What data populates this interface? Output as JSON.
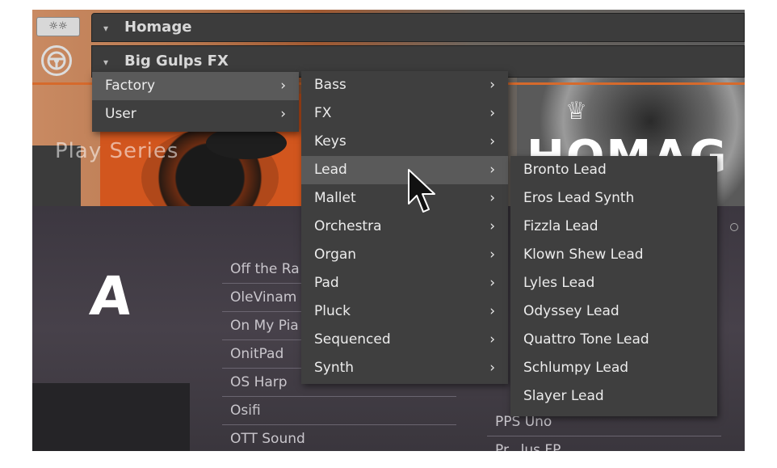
{
  "header": {
    "settings_label": "☼☼",
    "instrument_title": "Homage",
    "preset_title": "Big Gulps FX"
  },
  "banner": {
    "play_series": "Play Series",
    "logo_text": "HOMAG",
    "crown": "♕"
  },
  "body": {
    "big_letter": "A",
    "left_list": [
      "Off the Ra",
      "OleVinam",
      "On My Pia",
      "OnitPad",
      "OS Harp",
      "Osifi",
      "OTT Sound"
    ],
    "right_list": [
      "PPS Uno",
      "Pr...lus FP"
    ]
  },
  "menus": {
    "level1": [
      {
        "label": "Factory",
        "highlight": true
      },
      {
        "label": "User",
        "highlight": false
      }
    ],
    "level2": [
      {
        "label": "Bass",
        "highlight": false
      },
      {
        "label": "FX",
        "highlight": false
      },
      {
        "label": "Keys",
        "highlight": false
      },
      {
        "label": "Lead",
        "highlight": true
      },
      {
        "label": "Mallet",
        "highlight": false
      },
      {
        "label": "Orchestra",
        "highlight": false
      },
      {
        "label": "Organ",
        "highlight": false
      },
      {
        "label": "Pad",
        "highlight": false
      },
      {
        "label": "Pluck",
        "highlight": false
      },
      {
        "label": "Sequenced",
        "highlight": false
      },
      {
        "label": "Synth",
        "highlight": false
      }
    ],
    "level3": [
      "Bronto Lead",
      "Eros Lead Synth",
      "Fizzla Lead",
      "Klown Shew Lead",
      "Lyles Lead",
      "Odyssey Lead",
      "Quattro Tone Lead",
      "Schlumpy Lead",
      "Slayer Lead"
    ],
    "chevron": "›",
    "caret": "▾"
  },
  "colors": {
    "menu_bg": "#3f3f3f",
    "menu_highlight": "#5a5a5a",
    "accent_orange": "#d66a2c"
  },
  "icons": {
    "settings": "gear-icon",
    "logo": "steering-wheel-icon",
    "submenu": "chevron-right-icon",
    "dropdown": "caret-down-icon",
    "cursor": "arrow-cursor-icon"
  }
}
